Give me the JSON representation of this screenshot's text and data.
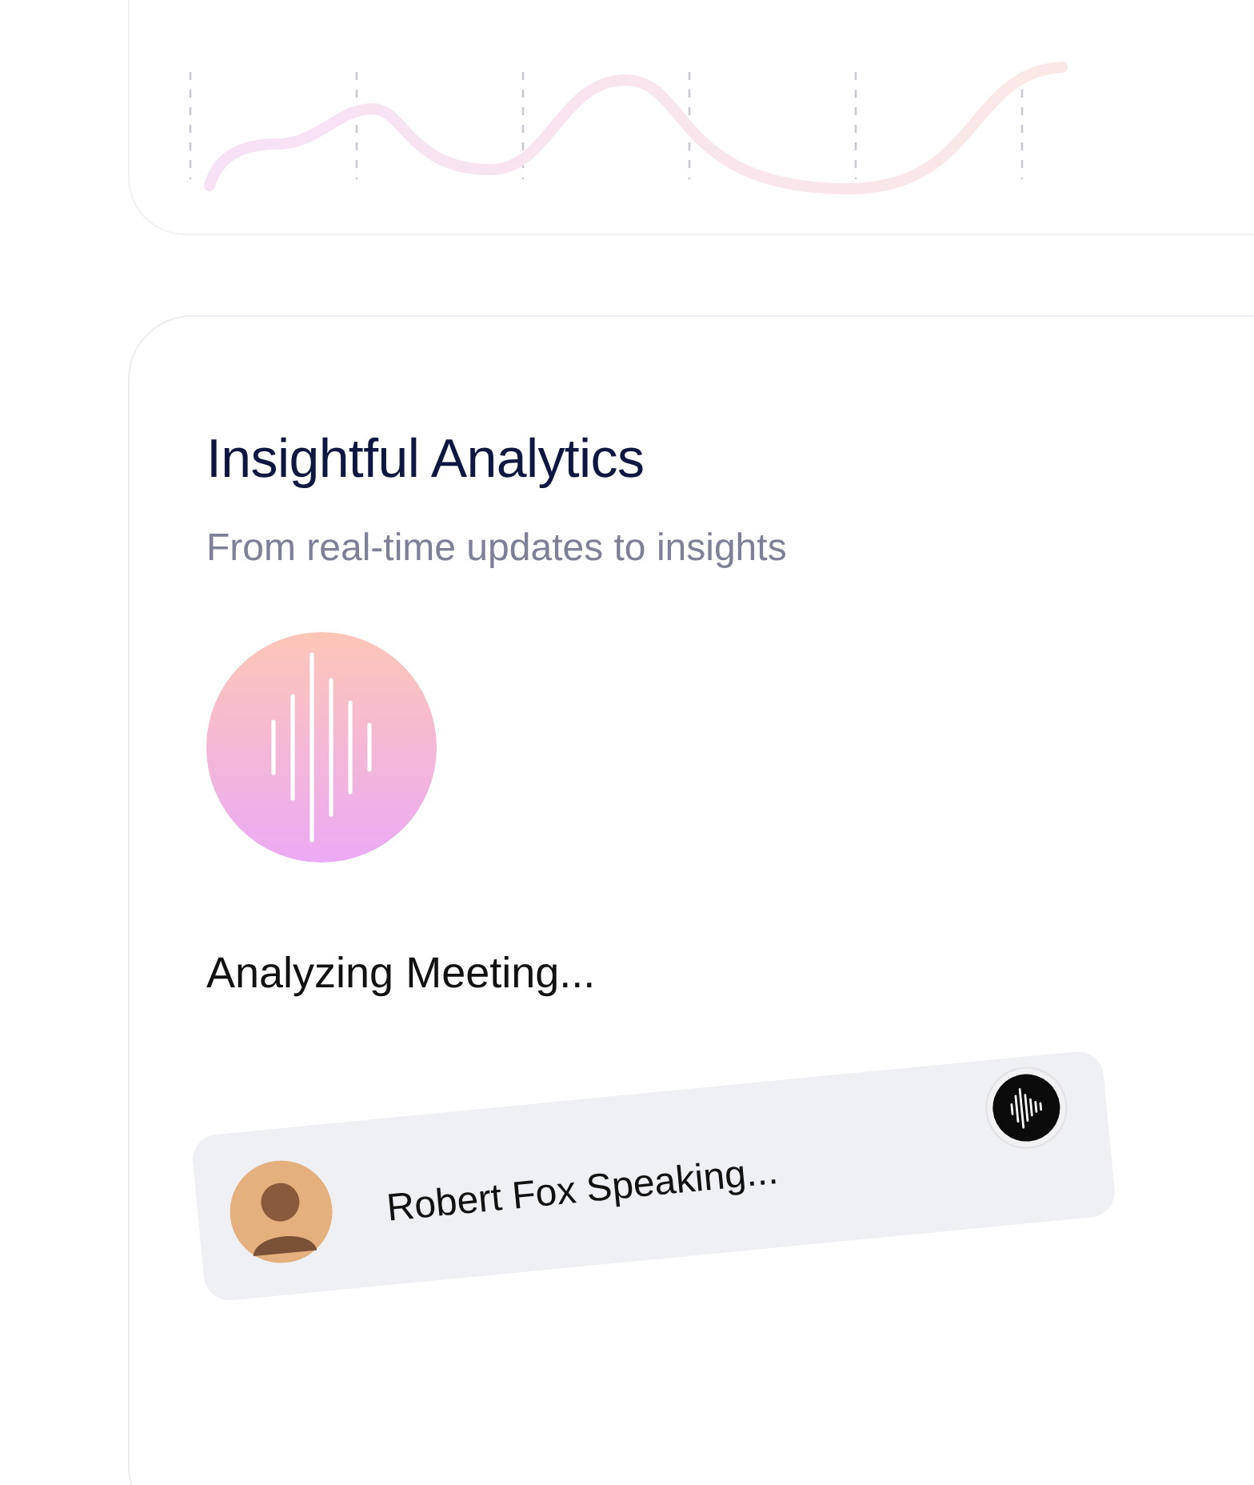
{
  "feature_card": {
    "title": "Insightful Analytics",
    "subtitle": "From real-time updates to insights",
    "status": "Analyzing Meeting...",
    "speaker": {
      "label": "Robert Fox Speaking..."
    }
  }
}
